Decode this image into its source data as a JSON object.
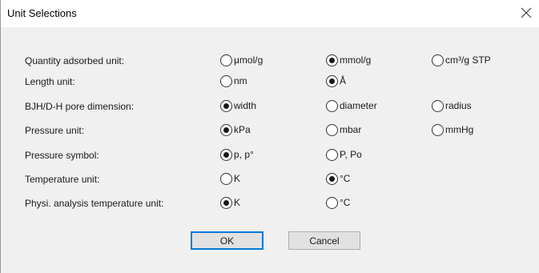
{
  "window": {
    "title": "Unit Selections"
  },
  "rows": [
    {
      "label": "Quantity adsorbed unit:",
      "options": [
        {
          "label": "μmol/g",
          "checked": false
        },
        {
          "label": "mmol/g",
          "checked": true
        },
        {
          "label": "cm³/g STP",
          "checked": false
        }
      ]
    },
    {
      "label": "Length unit:",
      "options": [
        {
          "label": "nm",
          "checked": false
        },
        {
          "label": "Å",
          "checked": true
        }
      ]
    },
    {
      "label": "BJH/D-H pore dimension:",
      "options": [
        {
          "label": "width",
          "checked": true
        },
        {
          "label": "diameter",
          "checked": false
        },
        {
          "label": "radius",
          "checked": false
        }
      ]
    },
    {
      "label": "Pressure unit:",
      "options": [
        {
          "label": "kPa",
          "checked": true
        },
        {
          "label": "mbar",
          "checked": false
        },
        {
          "label": "mmHg",
          "checked": false
        }
      ]
    },
    {
      "label": "Pressure symbol:",
      "options": [
        {
          "label": "p, p°",
          "checked": true
        },
        {
          "label": "P, Po",
          "checked": false
        }
      ]
    },
    {
      "label": "Temperature unit:",
      "options": [
        {
          "label": "K",
          "checked": false
        },
        {
          "label": "°C",
          "checked": true
        }
      ]
    },
    {
      "label": "Physi. analysis temperature unit:",
      "options": [
        {
          "label": "K",
          "checked": true
        },
        {
          "label": "°C",
          "checked": false
        }
      ]
    }
  ],
  "buttons": {
    "ok_label": "OK",
    "cancel_label": "Cancel"
  },
  "icons": {
    "close": "close-icon",
    "radio": "radio-button"
  },
  "colors": {
    "dialog_bg": "#f0f0f0",
    "titlebar_bg": "#ffffff",
    "default_button_border": "#0078d7",
    "button_bg": "#e1e1e1"
  }
}
